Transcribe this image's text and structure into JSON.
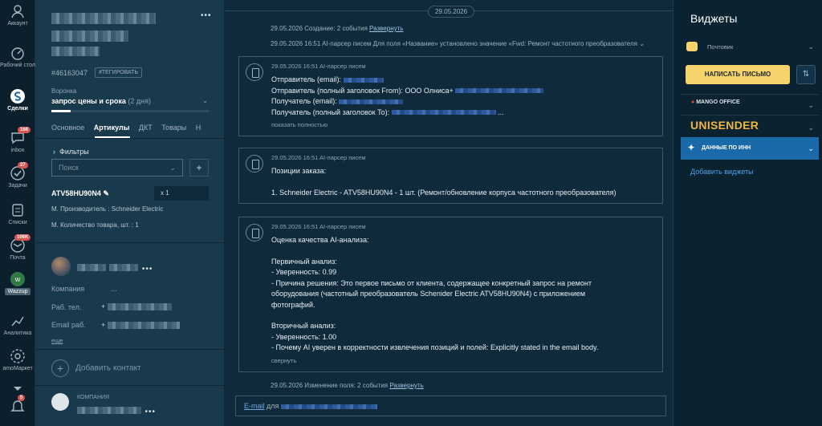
{
  "nav": {
    "items": [
      {
        "label": "Аккаунт"
      },
      {
        "label": "Рабочий стол"
      },
      {
        "label": "Сделки"
      },
      {
        "label": "inbox",
        "badge": "168"
      },
      {
        "label": "Задачи",
        "badge": "27"
      },
      {
        "label": "Списки"
      },
      {
        "label": "Почта",
        "badge": "106K"
      },
      {
        "label": "Wazzup"
      },
      {
        "label": "Аналитика"
      },
      {
        "label": "amoМаркет"
      }
    ],
    "bottom_badge": "5"
  },
  "lead": {
    "id": "#46163047",
    "tag_button": "#ТЕГИРОВАТЬ",
    "funnel_label": "Воронка",
    "funnel_value": "запрос цены и срока",
    "funnel_days": "(2 дня)",
    "progress": 0.12,
    "tabs": [
      "Основное",
      "Артикулы",
      "ДКТ",
      "Товары",
      "Н"
    ],
    "active_tab": "Артикулы",
    "filters_label": "Фильтры",
    "search_placeholder": "Поиск",
    "sku": "ATV58HU90N4",
    "qty": "x 1",
    "attr_manufacturer": "М. Производитель :  Schneider Electric",
    "attr_quantity": "М. Количество товара, шт. :  1",
    "contact_fields": {
      "company": "Компания",
      "company_value": "...",
      "work_phone": "Раб. тел.",
      "work_email": "Email раб.",
      "more": "еще"
    },
    "add_contact": "Добавить контакт",
    "company_section_label": "КОМПАНИЯ"
  },
  "feed": {
    "date": "29.05.2026",
    "sys_1_prefix": "29.05.2026 Создание: 2 события",
    "sys_1_link": "Развернуть",
    "sys_2": "29.05.2026 16:51 AI-парсер писем Для поля «Название» установлено значение «Fwd: Ремонт частотного преобразователя",
    "note_1": {
      "meta": "29.05.2026 16:51 AI-парсер писем",
      "line_1": "Отправитель (email):",
      "line_2": "Отправитель (полный заголовок From): ООО Олниса+",
      "line_3": "Получатель (email):",
      "line_4": "Получатель (полный заголовок To):",
      "line_4_tail": "...",
      "more": "показать полностью"
    },
    "note_2": {
      "meta": "29.05.2026 16:51 AI-парсер писем",
      "line_1": "Позиции заказа:",
      "line_2": "1. Schneider Electric - ATV58HU90N4 - 1 шт. (Ремонт/обновление корпуса частотного преобразователя)"
    },
    "note_3": {
      "meta": "29.05.2026 16:51 AI-парсер писем",
      "line_1": "Оценка качества AI-анализа:",
      "line_2": "Первичный анализ:",
      "line_3": "- Уверенность: 0.99",
      "line_4": "- Причина решения: Это первое письмо от клиента, содержащее конкретный запрос на ремонт",
      "line_5": "оборудования (частотный преобразователь Schenider Electric ATV58HU90N4) с приложением",
      "line_6": "фотографий.",
      "line_7": "Вторичный анализ:",
      "line_8": "- Уверенность: 1.00",
      "line_9": "- Почему AI уверен в корректности извлечения позиций и полей: Explicitly stated in the email body.",
      "collapse": "свернуть"
    },
    "sys_3_prefix": "29.05.2026 Изменение поля: 2 события",
    "sys_3_link": "Развернуть",
    "compose_link": "E-mail",
    "compose_text": "для"
  },
  "widgets": {
    "title": "Виджеты",
    "mail_widget": "Почтовик",
    "write_button": "НАПИСАТЬ ПИСЬМО",
    "mango": "MANGO OFFICE",
    "unisender": "UNISENDER",
    "inn": "ДАННЫЕ ПО ИНН",
    "add_widgets": "Добавить виджеты"
  },
  "colors": {
    "accent_yellow": "#f5d36a",
    "link_blue": "#4ea0e6",
    "active_widget": "#1a6aaa",
    "badge_red": "#d9534f"
  }
}
